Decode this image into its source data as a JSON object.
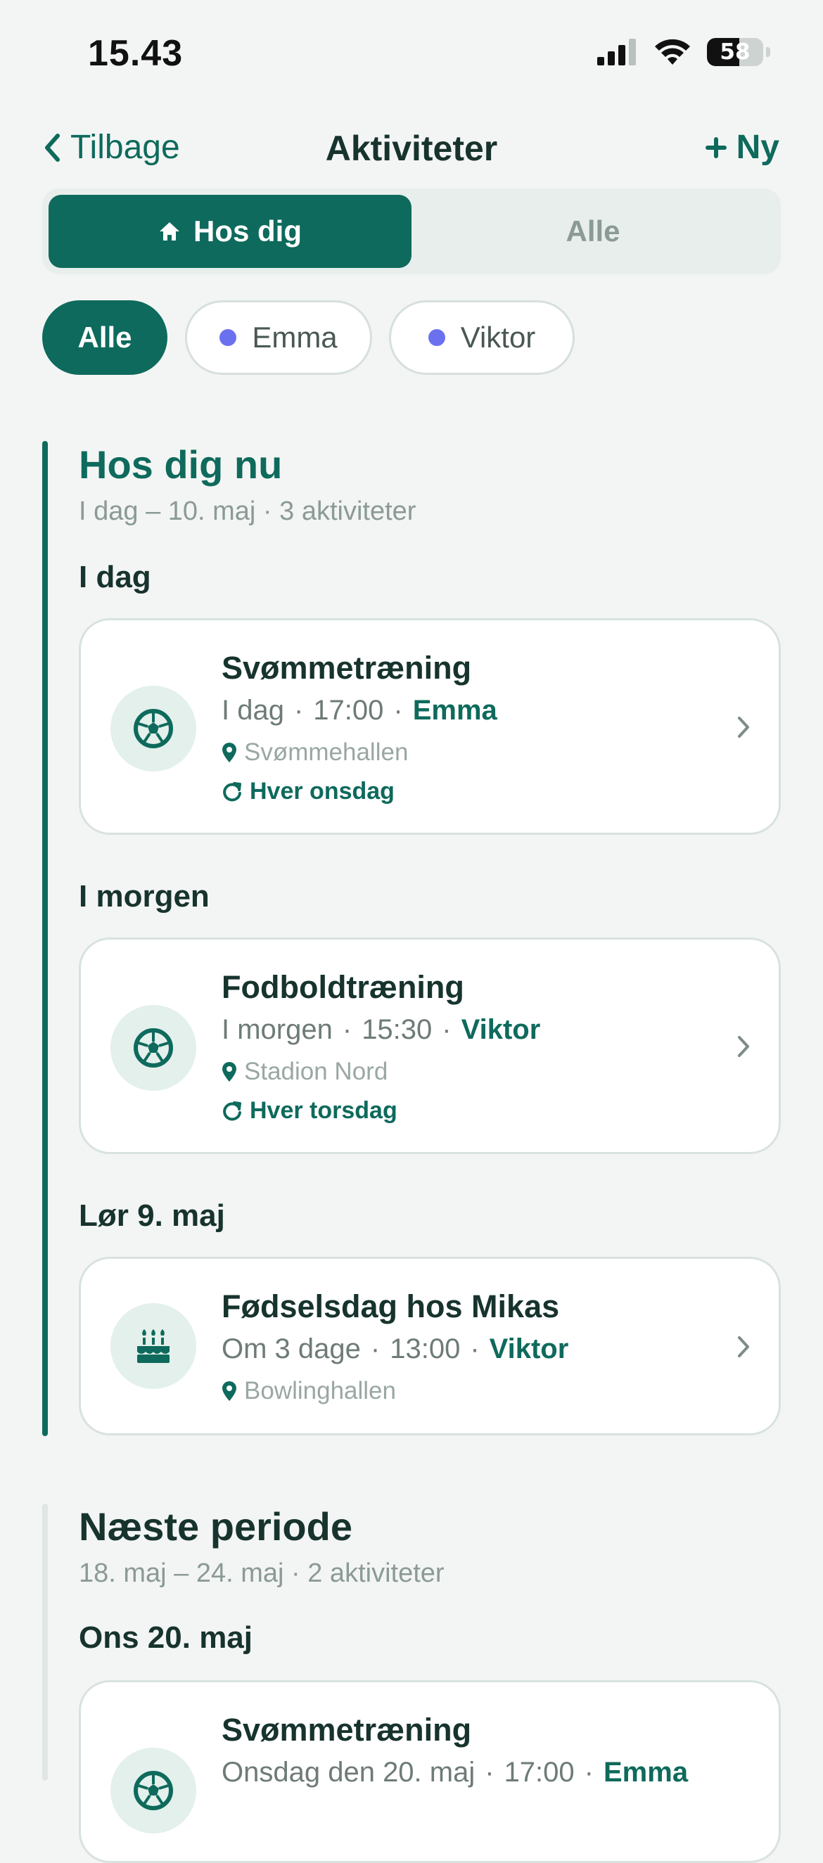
{
  "status_bar": {
    "time": "15.43",
    "battery": "58",
    "battery_level": 0.58
  },
  "nav": {
    "back_label": "Tilbage",
    "title": "Aktiviteter",
    "new_label": "Ny"
  },
  "segment": {
    "active_label": "Hos dig",
    "inactive_label": "Alle"
  },
  "filters": [
    {
      "label": "Alle",
      "active": true
    },
    {
      "label": "Emma",
      "active": false,
      "dot_color": "#6b70ef"
    },
    {
      "label": "Viktor",
      "active": false,
      "dot_color": "#6b70ef"
    }
  ],
  "colors": {
    "accent": "#0e6a5c",
    "person_dot": "#6b70ef"
  },
  "sections": [
    {
      "title": "Hos dig nu",
      "subtitle": "I dag – 10. maj · 3 aktiviteter",
      "days": [
        {
          "label": "I dag",
          "items": [
            {
              "title": "Svømmetræning",
              "when": "I dag",
              "time": "17:00",
              "person": "Emma",
              "location": "Svømmehallen",
              "recurrence": "Hver onsdag",
              "icon": "soccer-ball-icon"
            }
          ]
        },
        {
          "label": "I morgen",
          "items": [
            {
              "title": "Fodboldtræning",
              "when": "I morgen",
              "time": "15:30",
              "person": "Viktor",
              "location": "Stadion Nord",
              "recurrence": "Hver torsdag",
              "icon": "soccer-ball-icon"
            }
          ]
        },
        {
          "label": "Lør 9. maj",
          "items": [
            {
              "title": "Fødselsdag hos Mikas",
              "when": "Om 3 dage",
              "time": "13:00",
              "person": "Viktor",
              "location": "Bowlinghallen",
              "icon": "birthday-cake-icon"
            }
          ]
        }
      ]
    },
    {
      "title": "Næste periode",
      "subtitle": "18. maj – 24. maj · 2 aktiviteter",
      "days": [
        {
          "label": "Ons 20. maj",
          "items": [
            {
              "title": "Svømmetræning",
              "when": "Onsdag den 20. maj",
              "time": "17:00",
              "person": "Emma",
              "icon": "soccer-ball-icon"
            }
          ]
        }
      ]
    }
  ]
}
